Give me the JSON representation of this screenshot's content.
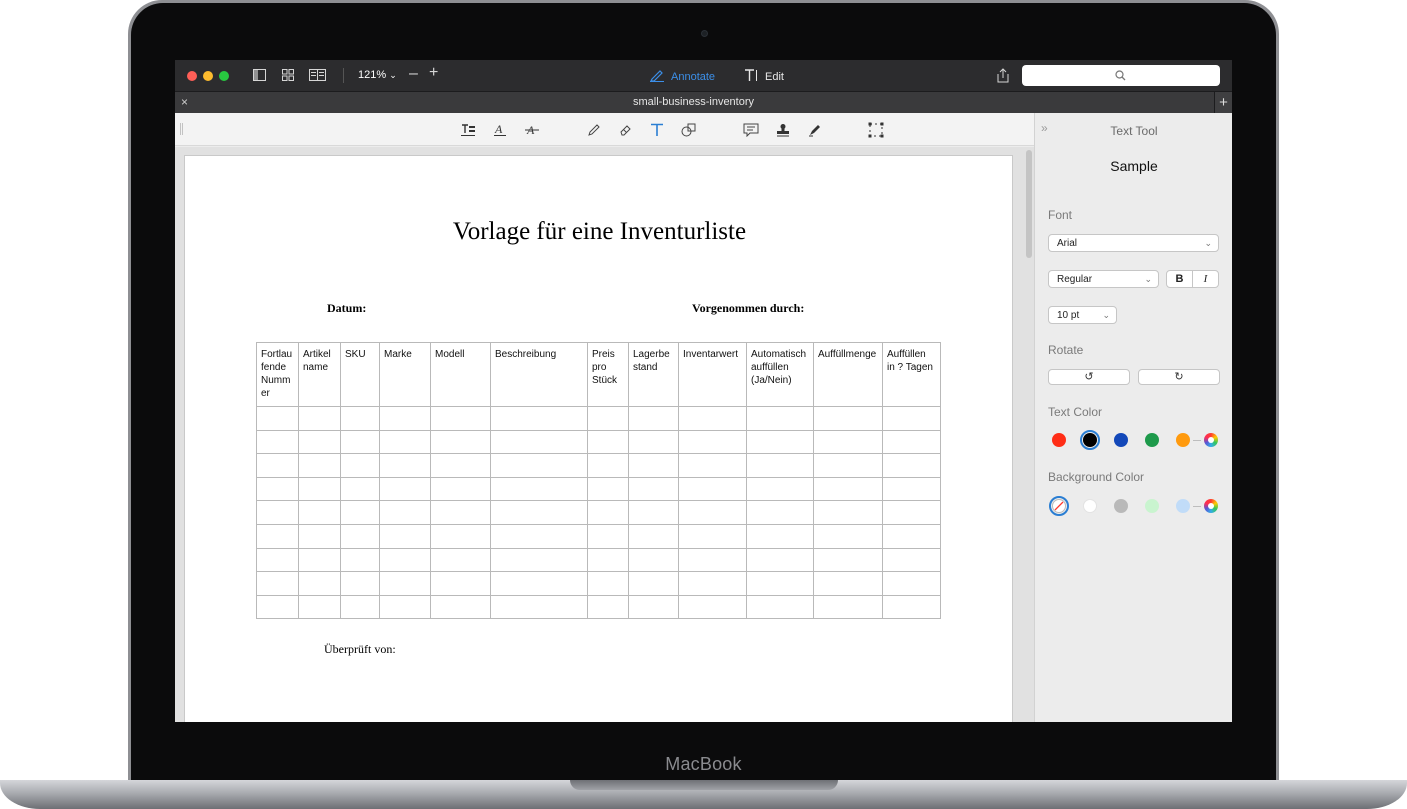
{
  "device": {
    "brand": "MacBook"
  },
  "window": {
    "zoom": "121%",
    "modes": {
      "annotate": "Annotate",
      "edit": "Edit"
    },
    "document_tab": "small-business-inventory",
    "close_glyph": "×",
    "add_glyph": "+"
  },
  "colors": {
    "accent": "#2a7ed3",
    "titlebar": "#2c2c2e"
  },
  "document": {
    "title": "Vorlage für eine Inventurliste",
    "date_label": "Datum:",
    "performed_by_label": "Vorgenommen durch:",
    "checked_by_label": "Überprüft von:",
    "table": {
      "headers": [
        "Fortlau fende Numm er",
        "Artikel name",
        "SKU",
        "Marke",
        "Modell",
        "Beschreibung",
        "Preis pro Stück",
        "Lagerbe stand",
        "Inventarwert",
        "Automatisch auffüllen (Ja/Nein)",
        "Auffüllmenge",
        "Auffüllen in ? Tagen"
      ],
      "empty_rows": 9
    }
  },
  "panel": {
    "title": "Text Tool",
    "sample": "Sample",
    "font_label": "Font",
    "font_family": "Arial",
    "font_style": "Regular",
    "bold": "B",
    "italic": "I",
    "font_size": "10 pt",
    "rotate_label": "Rotate",
    "text_color_label": "Text Color",
    "text_colors": [
      "#ff2d16",
      "#000000",
      "#1348b9",
      "#1e9a4b",
      "#ff9a0e"
    ],
    "text_color_selected": "#000000",
    "background_color_label": "Background Color",
    "background_colors": [
      "#ffffff",
      "#b9b9b9",
      "#c9f4cf",
      "#c1dcf8"
    ],
    "background_selected": "none"
  }
}
